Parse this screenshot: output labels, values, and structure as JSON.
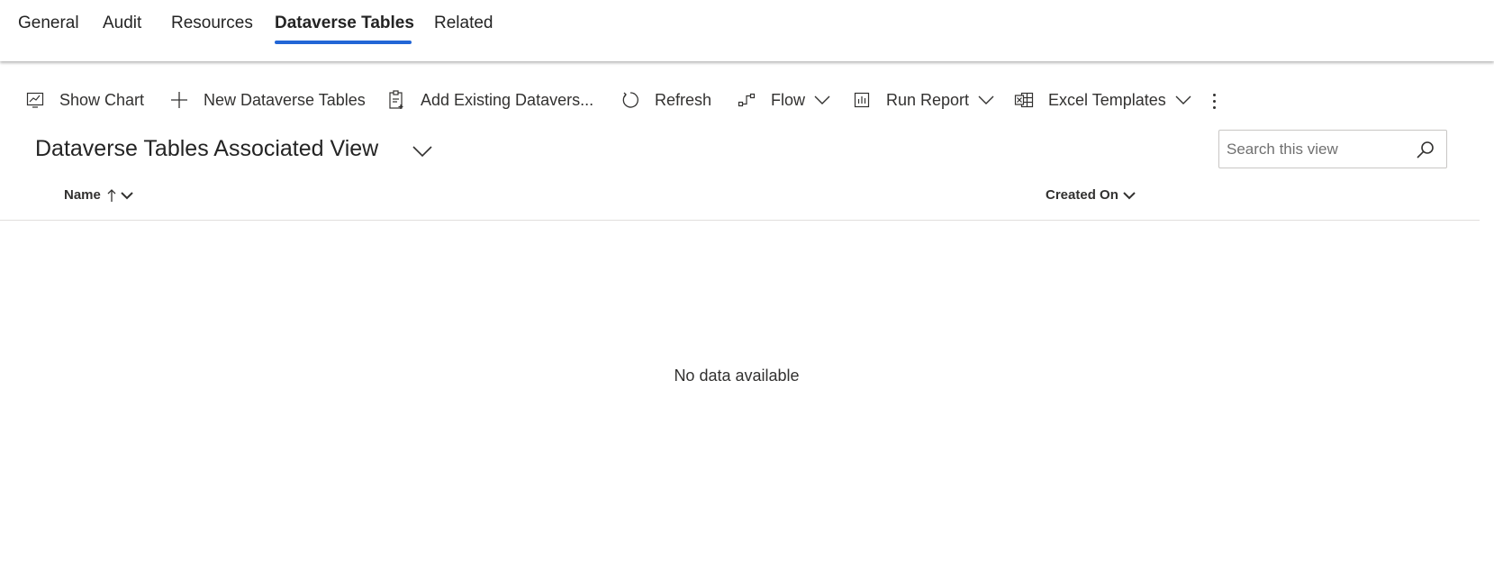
{
  "tabs": [
    {
      "label": "General"
    },
    {
      "label": "Audit"
    },
    {
      "label": "Resources"
    },
    {
      "label": "Dataverse Tables",
      "active": true
    },
    {
      "label": "Related"
    }
  ],
  "commands": {
    "show_chart": "Show Chart",
    "new_record": "New Dataverse Tables",
    "add_existing": "Add Existing Datavers...",
    "refresh": "Refresh",
    "flow": "Flow",
    "run_report": "Run Report",
    "excel_templates": "Excel Templates"
  },
  "view": {
    "title": "Dataverse Tables Associated View"
  },
  "search": {
    "placeholder": "Search this view",
    "value": ""
  },
  "grid": {
    "columns": [
      {
        "label": "Name",
        "sort": "ascending"
      },
      {
        "label": "Created On"
      }
    ],
    "empty_message": "No data available"
  },
  "colors": {
    "accent": "#2266d6",
    "text": "#242424",
    "divider": "#e1dfdd"
  },
  "icons": {
    "show_chart": "chart-icon",
    "new_record": "plus-icon",
    "add_existing": "clipboard-add-icon",
    "refresh": "refresh-icon",
    "flow": "flow-icon",
    "run_report": "report-icon",
    "excel_templates": "excel-icon",
    "more": "more-vertical-icon",
    "search": "search-icon"
  }
}
